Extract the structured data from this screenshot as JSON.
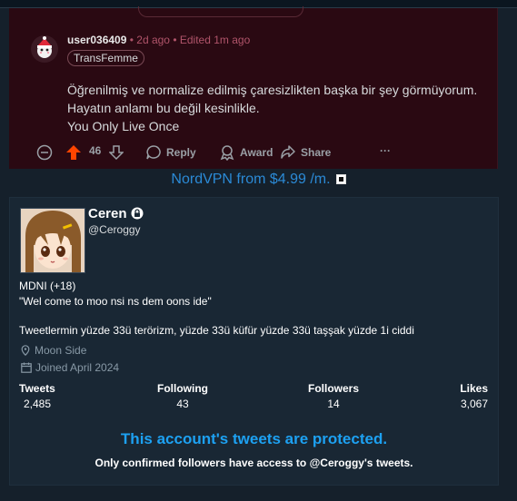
{
  "comment": {
    "username": "user036409",
    "separator": "•",
    "time_ago": "2d ago",
    "edited": "Edited 1m ago",
    "flair": "TransFemme",
    "body_lines": [
      "Öğrenilmiş ve normalize edilmiş çaresizlikten başka bir şey görmüyorum.",
      "Hayatın anlamı bu değil kesinlikle.",
      "You Only Live Once"
    ],
    "score": "46",
    "reply_label": "Reply",
    "award_label": "Award",
    "share_label": "Share",
    "more_label": "···"
  },
  "ad": {
    "text": "NordVPN from $4.99 /m."
  },
  "profile": {
    "name": "Ceren",
    "handle": "@Ceroggy",
    "bio_line1": "MDNI (+18)",
    "bio_line2": "\"Wel come to moo nsi ns dem oons ide\"",
    "bio_line3": "Tweetlermin  yüzde 33ü terörizm, yüzde 33ü küfür yüzde 33ü taşşak yüzde 1i ciddi",
    "location": "Moon Side",
    "joined": "Joined April 2024",
    "stats": [
      {
        "label": "Tweets",
        "value": "2,485"
      },
      {
        "label": "Following",
        "value": "43"
      },
      {
        "label": "Followers",
        "value": "14"
      },
      {
        "label": "Likes",
        "value": "3,067"
      }
    ],
    "protected_title": "This account's tweets are protected.",
    "protected_sub": "Only confirmed followers have access to @Ceroggy's tweets."
  },
  "colors": {
    "card_bg": "#2a0912",
    "upvote": "#ff4500",
    "accent_blue": "#1da1f2",
    "ad_blue": "#2b8ad6"
  }
}
